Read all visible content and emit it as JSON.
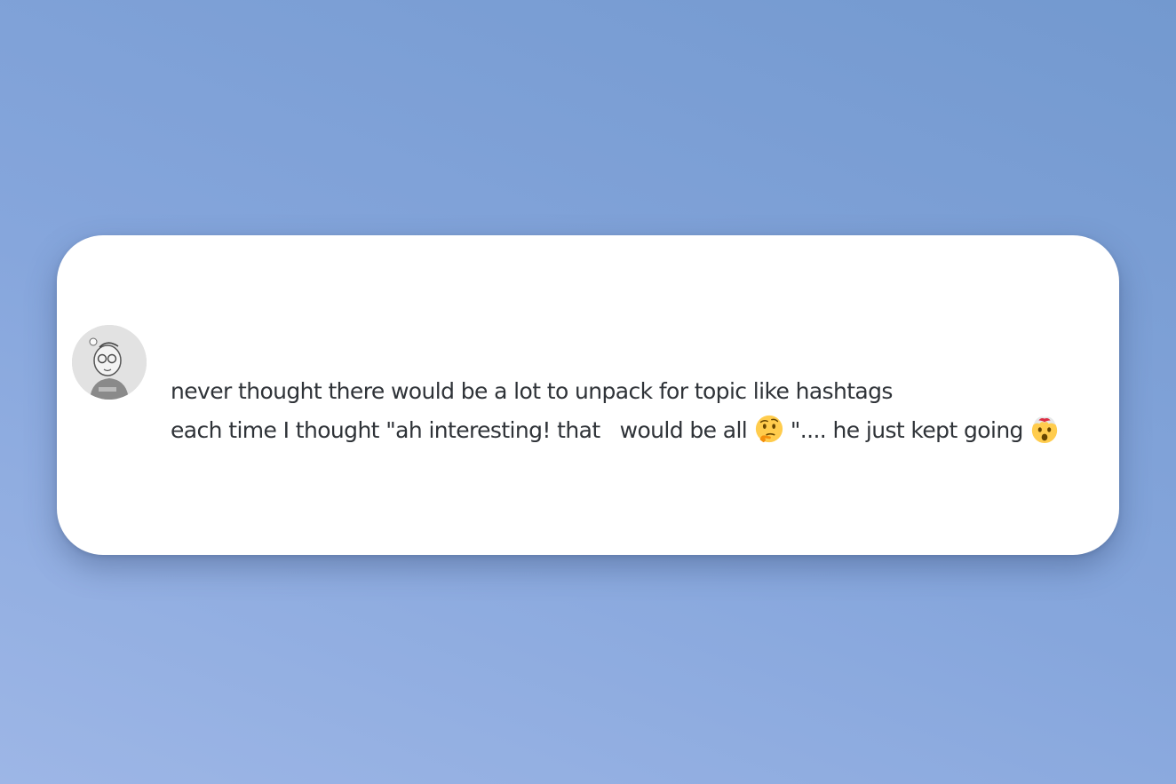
{
  "comment": {
    "author": "",
    "lines": [
      {
        "text": "never thought there would be a lot to unpack for topic like hashtags"
      },
      {
        "part1": "each time I thought \"ah interesting! that   would be all ",
        "emoji1": "thinking-face-icon",
        "part2": " \".... he just kept going ",
        "emoji2": "exploding-head-icon"
      }
    ]
  },
  "colors": {
    "background_top": "#7399cf",
    "background_bottom": "#9db6e6",
    "card": "#ffffff",
    "text": "#2f3338"
  }
}
